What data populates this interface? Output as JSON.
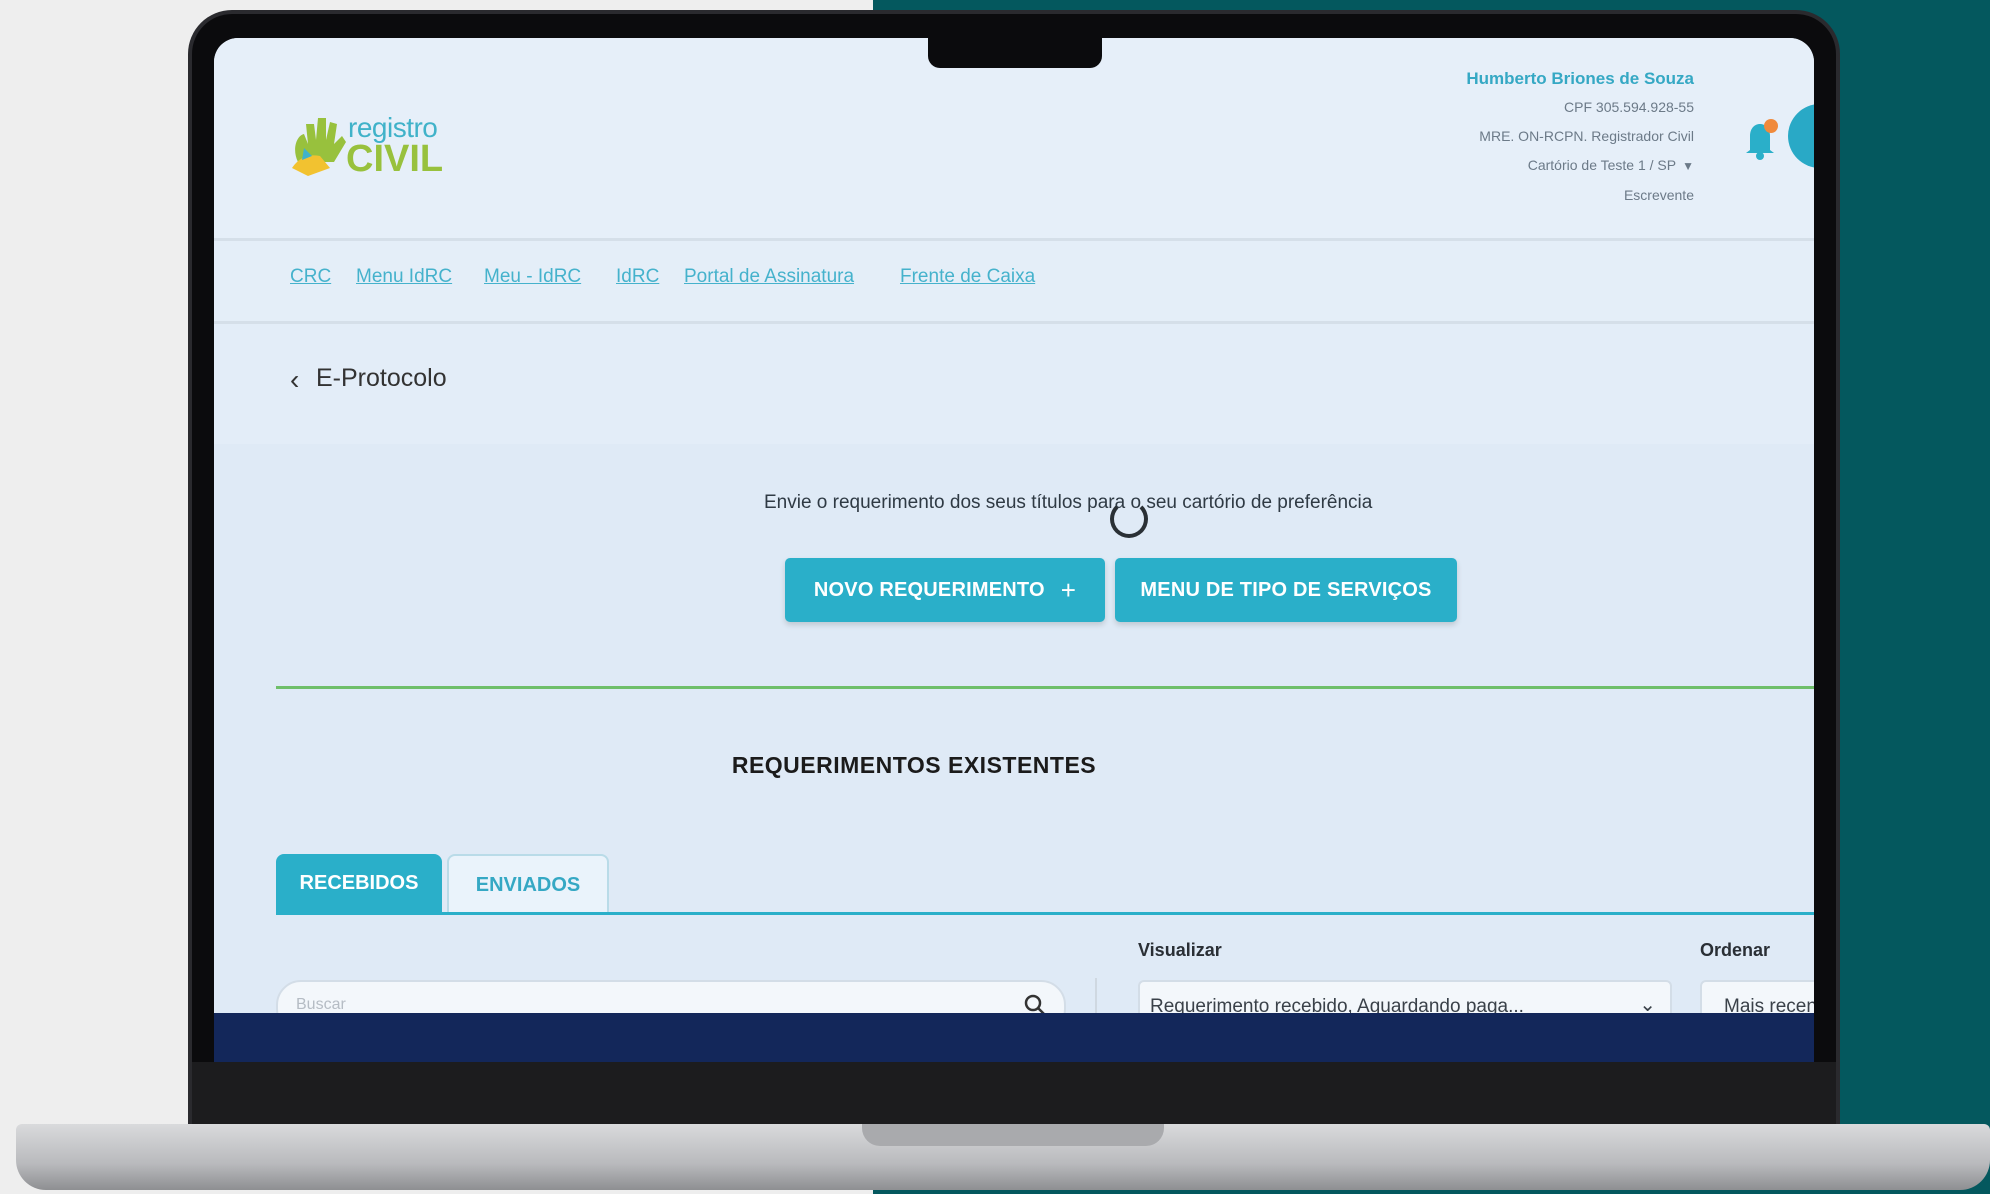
{
  "logo": {
    "line1": "registro",
    "line2": "CIVIL"
  },
  "user": {
    "name": "Humberto Briones de Souza",
    "cpf": "CPF 305.594.928-55",
    "role": "MRE. ON-RCPN. Registrador Civil",
    "office": "Cartório de Teste 1 / SP",
    "level": "Escrevente",
    "notifications": "0"
  },
  "nav": [
    "CRC",
    "Menu IdRC",
    "Meu - IdRC",
    "IdRC",
    "Portal de Assinatura",
    "Frente de Caixa"
  ],
  "page": {
    "back": "‹",
    "title": "E-Protocolo"
  },
  "intro": "Envie o requerimento dos seus títulos para o seu cartório de preferência",
  "buttons": {
    "new_request": "NOVO REQUERIMENTO",
    "new_request_plus": "+",
    "service_menu": "MENU DE TIPO DE SERVIÇOS"
  },
  "section_title": "REQUERIMENTOS EXISTENTES",
  "tabs": {
    "received": "RECEBIDOS",
    "sent": "ENVIADOS"
  },
  "filters": {
    "search_placeholder": "Buscar",
    "view_label": "Visualizar",
    "view_value": "Requerimento recebido, Aguardando paga...",
    "order_label": "Ordenar",
    "order_value": "Mais recentes"
  },
  "colors": {
    "accent": "#2aafc9",
    "brand_green": "#98c13d",
    "footer": "#13275a",
    "divider_green": "#6fbf6a"
  }
}
